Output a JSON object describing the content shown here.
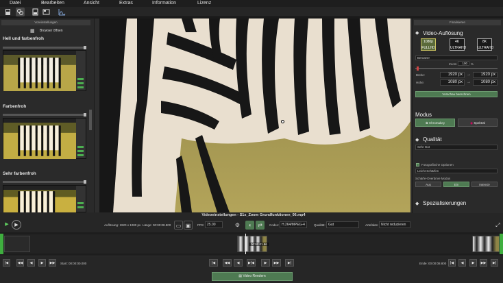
{
  "menu": [
    "Datei",
    "Bearbeiten",
    "Ansicht",
    "Extras",
    "Information",
    "Lizenz"
  ],
  "left_panel": {
    "header": "Voreinstellungen",
    "browse_label": "Browser öffnen",
    "presets": [
      {
        "title": "Hell und farbenfroh"
      },
      {
        "title": "Farbenfroh"
      },
      {
        "title": "Sehr farbenfroh"
      }
    ]
  },
  "video": {
    "title": "Videoeinstellungen - S1x_Zoom Grundfunktionen_06.mp4"
  },
  "right_panel": {
    "top": "Finalisieren",
    "resolution": {
      "title": "Video-Auflösung",
      "options": [
        {
          "top": "1080p",
          "bottom": "FULLHD",
          "selected": true
        },
        {
          "top": "4K",
          "bottom": "ULTRAHD",
          "selected": false
        },
        {
          "top": "8K",
          "bottom": "ULTRAHD",
          "selected": false
        }
      ],
      "preset_dropdown": "Benutzer",
      "zoom_label": "Zoom",
      "zoom_value": "100",
      "zoom_unit": "%",
      "width_label": "Breite:",
      "height_label": "Höhe:",
      "width_in": "1920 px",
      "width_out": "1920 px",
      "height_in": "1080 px",
      "height_out": "1080 px",
      "apply_button": "Vorschau berechnen"
    },
    "mode": {
      "title": "Modus",
      "options": [
        "Chromakey",
        "Spektral"
      ]
    },
    "quality": {
      "title": "Qualität",
      "dropdown": "Sehr Gut",
      "checkbox_label": "Fotografische Optionen",
      "sharpness_dropdown": "Leicht Schärfen",
      "overdrive_label": "Schärfe-Overdrive Modus",
      "overdrive_options": [
        "Aus",
        "Ein",
        "Intensiv"
      ],
      "overdrive_selected": 1
    },
    "special": {
      "title": "Spezialisierungen"
    }
  },
  "settings_bar": {
    "resolution_label": "Auflösung: 1920 x 1080 px",
    "length_label": "Länge: 00:00:08.800",
    "fps_label": "FPS:",
    "fps_value": "25.00",
    "codec_label": "Codec:",
    "codec_value": "H.264/MPEG-4",
    "quality_label": "Qualität:",
    "quality_value": "Gut",
    "artifacts_label": "Artefakte:",
    "artifacts_value": "Nicht reduzieren"
  },
  "timeline": {
    "current_time": "00:00:01.86"
  },
  "transport": {
    "start_label": "Start: 00:00:00.000",
    "end_label": "Ende: 00:00:08.800",
    "render_button": "Video Rendern"
  },
  "colors": {
    "accent_green": "#4e7a52",
    "bright_green": "#3fae3f"
  }
}
